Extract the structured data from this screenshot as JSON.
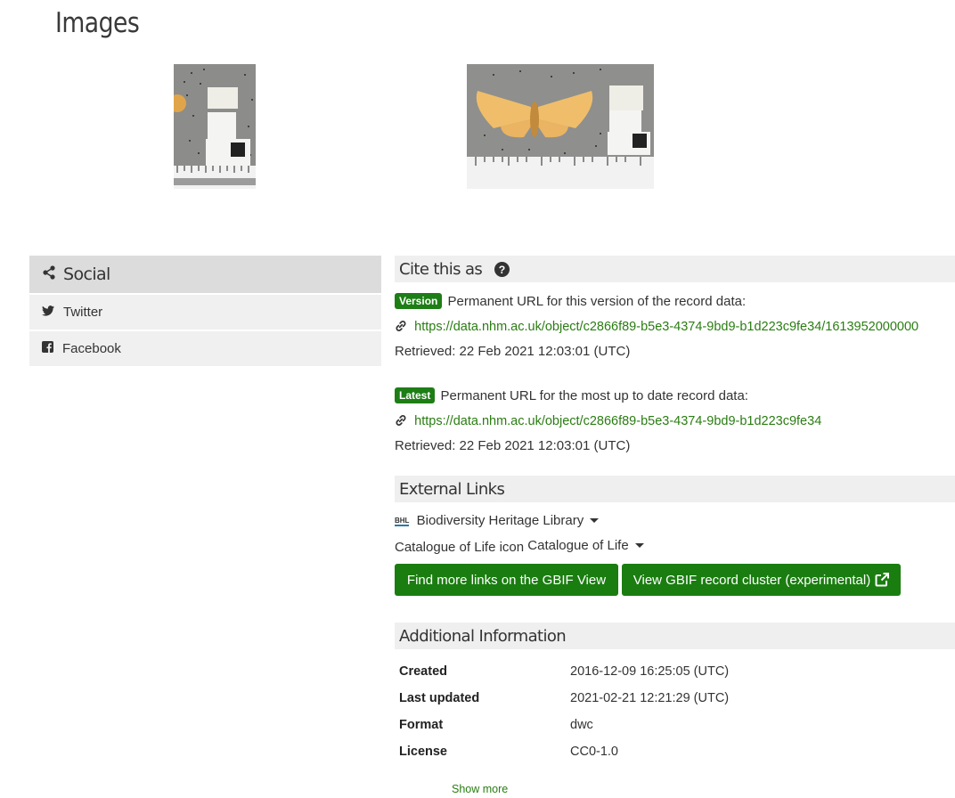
{
  "images": {
    "heading": "Images"
  },
  "social": {
    "title": "Social",
    "items": [
      {
        "label": "Twitter",
        "icon": "twitter-icon"
      },
      {
        "label": "Facebook",
        "icon": "facebook-icon"
      }
    ]
  },
  "cite": {
    "title": "Cite this as",
    "version": {
      "badge": "Version",
      "text": "Permanent URL for this version of the record data:",
      "url": "https://data.nhm.ac.uk/object/c2866f89-b5e3-4374-9bd9-b1d223c9fe34/1613952000000",
      "retrieved": "Retrieved: 22 Feb 2021 12:03:01 (UTC)"
    },
    "latest": {
      "badge": "Latest",
      "text": "Permanent URL for the most up to date record data:",
      "url": "https://data.nhm.ac.uk/object/c2866f89-b5e3-4374-9bd9-b1d223c9fe34",
      "retrieved": "Retrieved: 22 Feb 2021 12:03:01 (UTC)"
    }
  },
  "external_links": {
    "title": "External Links",
    "bhl_icon_text": "BHL",
    "bhl_label": "Biodiversity Heritage Library",
    "col_icon_alt": "Catalogue of Life icon",
    "col_label": "Catalogue of Life",
    "gbif_button": "Find more links on the GBIF View",
    "cluster_button": "View GBIF record cluster (experimental)"
  },
  "additional": {
    "title": "Additional Information",
    "rows": [
      {
        "key": "Created",
        "value": "2016-12-09 16:25:05 (UTC)"
      },
      {
        "key": "Last updated",
        "value": "2021-02-21 12:21:29 (UTC)"
      },
      {
        "key": "Format",
        "value": "dwc"
      },
      {
        "key": "License",
        "value": "CC0-1.0"
      }
    ],
    "show_more": "Show more"
  },
  "colors": {
    "accent_green": "#1a7d10",
    "link_green": "#2a7d12"
  }
}
